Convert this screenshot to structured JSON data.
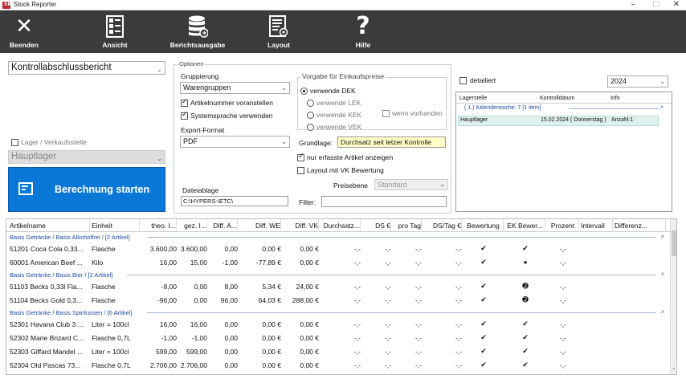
{
  "window": {
    "title": "Stock Reporter",
    "icon_text": "SR",
    "min": "–",
    "max": "□",
    "close": "✕"
  },
  "ribbon": [
    {
      "id": "beenden",
      "label": "Beenden",
      "icon": "close-x-icon"
    },
    {
      "id": "ansicht",
      "label": "Ansicht",
      "icon": "view-list-icon"
    },
    {
      "id": "berichtsausgabe",
      "label": "Berichtsausgabe",
      "icon": "database-icon"
    },
    {
      "id": "layout",
      "label": "Layout",
      "icon": "layout-doc-icon"
    },
    {
      "id": "hilfe",
      "label": "Hilfe",
      "icon": "question-icon"
    }
  ],
  "left": {
    "report_select": "Kontrollabschlussbericht",
    "lager_checkbox": "Lager / Verkaufsstelle",
    "lager_select": "Hauptlager",
    "start_button": "Berechnung starten"
  },
  "options": {
    "title": "Optionen",
    "grouping_label": "Gruppierung",
    "grouping_value": "Warengruppen",
    "chk_article": "Artikelnummer voranstellen",
    "chk_system": "Systemsprache verwenden",
    "export_label": "Export-Format",
    "export_value": "PDF",
    "storage_label": "Dateiablage",
    "storage_value": "C:\\HYPERS-\\ETC\\",
    "purchase_title": "Vorgabe für Einkaufspreise",
    "radios": [
      "verwende DEK",
      "verwende LEK",
      "verwende KEK",
      "verwende VEK"
    ],
    "if_available": "wenn vorhanden",
    "basis_label": "Grundlage:",
    "basis_value": "Durchsatz seit letzer Kontrolle",
    "chk_only_captured": "nur erfasste Artikel anzeigen",
    "chk_layout_vk": "Layout mit VK Bewertung",
    "price_level_label": "Preisebene",
    "price_level_value": "Standard",
    "filter_label": "Filter:"
  },
  "right": {
    "detailed": "detailiert",
    "year": "2024",
    "columns": [
      "Lagerstelle",
      "Kontrolldatum",
      "Info"
    ],
    "group": "( 1.) Kalenderwoche: 7 [1 item]",
    "row": [
      "Hauptlager",
      "15.02.2024 ( Donnerstag )",
      "Anzahl:1"
    ]
  },
  "grid": {
    "headers": [
      "Artikelname",
      "Einheit",
      "theo. I...",
      "gez. I...",
      "Diff. A...",
      "Diff. WE",
      "Diff. VK",
      "Durchsatz...",
      "DS €",
      "pro Tag",
      "DS/Tag €",
      "Bewertung",
      "EK Bewer...",
      "Prozent",
      "Intervall",
      "Differenz..."
    ],
    "groups": [
      {
        "title": "Basis Getränke /  Basis Alkoholfrei /  [2 Artikel]",
        "rows": [
          [
            "51201 Coca Cola 0,33...",
            "Flasche",
            "3.600,00",
            "3.600,00",
            "0,00",
            "0,00 €",
            "0,00 €",
            "-,-",
            "-,-",
            "-,-",
            "-,-",
            "✔",
            "✔",
            "-,-"
          ],
          [
            "60001 American Beef ...",
            "Kilo",
            "16,00",
            "15,00",
            "-1,00",
            "-77,89 €",
            "0,00 €",
            "-,-",
            "-,-",
            "-,-",
            "-,-",
            "✔",
            "✖",
            "-,-"
          ]
        ]
      },
      {
        "title": "Basis Getränke /  Basis Bier /  [2 Artikel]",
        "rows": [
          [
            "51103 Becks 0,33l Fla...",
            "Flasche",
            "-8,00",
            "0,00",
            "8,00",
            "5,34 €",
            "24,00 €",
            "-,-",
            "-,-",
            "-,-",
            "-,-",
            "✔",
            "➋",
            "-,-"
          ],
          [
            "51104 Becks Gold 0,3...",
            "Flasche",
            "-96,00",
            "0,00",
            "96,00",
            "64,03 €",
            "288,00 €",
            "-,-",
            "-,-",
            "-,-",
            "-,-",
            "✔",
            "➋",
            "-,-"
          ]
        ]
      },
      {
        "title": "Basis Getränke /  Basis Spirituosen /  [6 Artikel]",
        "rows": [
          [
            "52301 Havana Club 3 ...",
            "Liter = 100cl",
            "16,00",
            "16,00",
            "0,00",
            "0,00 €",
            "0,00 €",
            "-,-",
            "-,-",
            "-,-",
            "-,-",
            "✔",
            "✔",
            "-,-"
          ],
          [
            "52302 Marie Brizard C...",
            "Flasche 0,7L",
            "-1,00",
            "-1,00",
            "0,00",
            "0,00 €",
            "0,00 €",
            "-,-",
            "-,-",
            "-,-",
            "-,-",
            "✔",
            "✔",
            "-,-"
          ],
          [
            "52303 Giffard Mandel ...",
            "Liter = 100cl",
            "599,00",
            "599,00",
            "0,00",
            "0,00 €",
            "0,00 €",
            "-,-",
            "-,-",
            "-,-",
            "-,-",
            "✔",
            "✔",
            "-,-"
          ],
          [
            "52304 Old Pascas 73...",
            "Flasche 0,7L",
            "2.706,00",
            "2.706,00",
            "0,00",
            "0,00 €",
            "0,00 €",
            "-,-",
            "-,-",
            "-,-",
            "-,-",
            "✔",
            "✔",
            "-,-"
          ]
        ]
      }
    ]
  },
  "colors": {
    "ribbon_bg": "#3b3b3b",
    "start_button": "#0a78d7",
    "basis_bg": "#ffffc8",
    "group_text": "#1d4aa0",
    "selected_row": "#dff0ee"
  }
}
